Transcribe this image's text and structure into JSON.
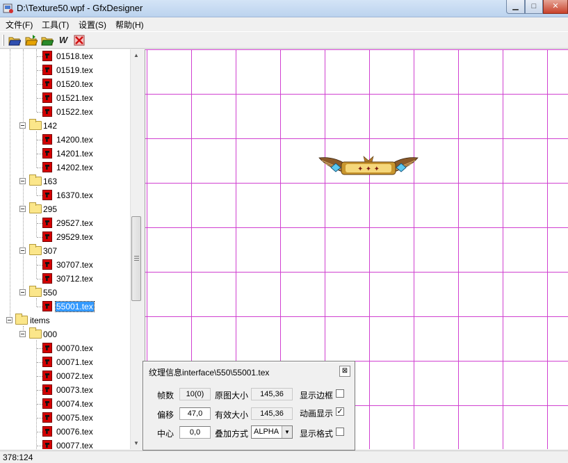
{
  "window": {
    "title": "D:\\Texture50.wpf - GfxDesigner"
  },
  "menu": [
    {
      "label": "文件(F)"
    },
    {
      "label": "工具(T)"
    },
    {
      "label": "设置(S)"
    },
    {
      "label": "帮助(H)"
    }
  ],
  "toolbar": {
    "icons": [
      "open-folder-icon",
      "open-folder-alt-icon",
      "save-folder-icon",
      "w-icon",
      "delete-icon"
    ],
    "w_label": "W"
  },
  "tree": {
    "items": [
      {
        "label": "01518.tex",
        "type": "file"
      },
      {
        "label": "01519.tex",
        "type": "file"
      },
      {
        "label": "01520.tex",
        "type": "file"
      },
      {
        "label": "01521.tex",
        "type": "file"
      },
      {
        "label": "01522.tex",
        "type": "file"
      },
      {
        "label": "142",
        "type": "folder"
      },
      {
        "label": "14200.tex",
        "type": "file"
      },
      {
        "label": "14201.tex",
        "type": "file"
      },
      {
        "label": "14202.tex",
        "type": "file"
      },
      {
        "label": "163",
        "type": "folder"
      },
      {
        "label": "16370.tex",
        "type": "file"
      },
      {
        "label": "295",
        "type": "folder"
      },
      {
        "label": "29527.tex",
        "type": "file"
      },
      {
        "label": "29529.tex",
        "type": "file"
      },
      {
        "label": "307",
        "type": "folder"
      },
      {
        "label": "30707.tex",
        "type": "file"
      },
      {
        "label": "30712.tex",
        "type": "file"
      },
      {
        "label": "550",
        "type": "folder"
      },
      {
        "label": "55001.tex",
        "type": "file",
        "selected": true
      },
      {
        "label": "items",
        "type": "root-folder"
      },
      {
        "label": "000",
        "type": "folder"
      },
      {
        "label": "00070.tex",
        "type": "file"
      },
      {
        "label": "00071.tex",
        "type": "file"
      },
      {
        "label": "00072.tex",
        "type": "file"
      },
      {
        "label": "00073.tex",
        "type": "file"
      },
      {
        "label": "00074.tex",
        "type": "file"
      },
      {
        "label": "00075.tex",
        "type": "file"
      },
      {
        "label": "00076.tex",
        "type": "file"
      },
      {
        "label": "00077.tex",
        "type": "file"
      }
    ]
  },
  "canvas": {
    "grid_color": "#d040d0",
    "sprite_icon": "winged-banner-sprite"
  },
  "dialog": {
    "title": "纹理信息interface\\550\\55001.tex",
    "frame_count_label": "帧数",
    "frame_count_value": "10(0)",
    "original_size_label": "原图大小",
    "original_size_value": "145,36",
    "show_border_label": "显示边框",
    "show_border_checked": false,
    "offset_label": "偏移",
    "offset_value": "47,0",
    "effective_size_label": "有效大小",
    "effective_size_value": "145,36",
    "animate_label": "动画显示",
    "animate_checked": true,
    "center_label": "中心",
    "center_value": "0,0",
    "blend_label": "叠加方式",
    "blend_value": "ALPHA",
    "show_grid_label": "显示格式",
    "show_grid_checked": false
  },
  "status": {
    "text": "378:124"
  }
}
